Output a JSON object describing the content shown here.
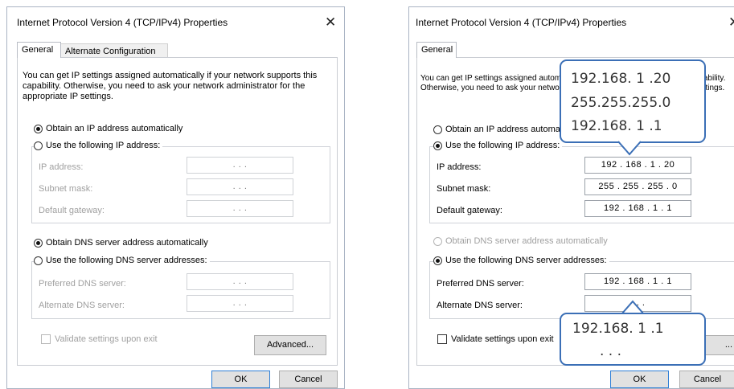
{
  "dialog_left": {
    "title": "Internet Protocol Version 4 (TCP/IPv4) Properties",
    "close_glyph": "✕",
    "tabs": [
      "General",
      "Alternate Configuration"
    ],
    "description": "You can get IP settings assigned automatically if your network supports this capability. Otherwise, you need to ask your network administrator for the appropriate IP settings.",
    "ip_auto": "Obtain an IP address automatically",
    "ip_manual": "Use the following IP address:",
    "labels": {
      "ip": "IP address:",
      "mask": "Subnet mask:",
      "gateway": "Default gateway:"
    },
    "ip_values": {
      "ip": ".   .   .",
      "mask": ".   .   .",
      "gateway": ".   .   ."
    },
    "dns_auto": "Obtain DNS server address automatically",
    "dns_manual": "Use the following DNS server addresses:",
    "dns_labels": {
      "preferred": "Preferred DNS server:",
      "alternate": "Alternate DNS server:"
    },
    "dns_values": {
      "preferred": ".   .   .",
      "alternate": ".   .   ."
    },
    "validate": "Validate settings upon exit",
    "advanced": "Advanced...",
    "ok": "OK",
    "cancel": "Cancel"
  },
  "dialog_right": {
    "title": "Internet Protocol Version 4 (TCP/IPv4) Properties",
    "close_glyph": "✕",
    "tabs": [
      "General"
    ],
    "description": "You can get IP settings assigned automatically if your network supports this capability. Otherwise, you need to ask your network administrator for the appropriate IP settings.",
    "ip_auto": "Obtain an IP address automatically",
    "ip_manual": "Use the following IP address:",
    "labels": {
      "ip": "IP address:",
      "mask": "Subnet mask:",
      "gateway": "Default gateway:"
    },
    "ip_values": {
      "ip": "192 . 168 . 1 . 20",
      "mask": "255 . 255 . 255 . 0",
      "gateway": "192 . 168 . 1 . 1"
    },
    "dns_auto": "Obtain DNS server address automatically",
    "dns_manual": "Use the following DNS server addresses:",
    "dns_labels": {
      "preferred": "Preferred DNS server:",
      "alternate": "Alternate DNS server:"
    },
    "dns_values": {
      "preferred": "192 . 168 . 1 . 1",
      "alternate": ".   .   ."
    },
    "validate": "Validate settings upon exit",
    "advanced": "...",
    "ok": "OK",
    "cancel": "Cancel"
  },
  "callout_top": {
    "ip": "192.168. 1 .20",
    "mask": "255.255.255.0",
    "gateway": "192.168. 1 .1"
  },
  "callout_bottom": {
    "preferred": "192.168. 1 .1",
    "alternate": ".     .     ."
  },
  "colors": {
    "callout_border": "#3b6fb6",
    "default_button_border": "#2f7fd6"
  }
}
